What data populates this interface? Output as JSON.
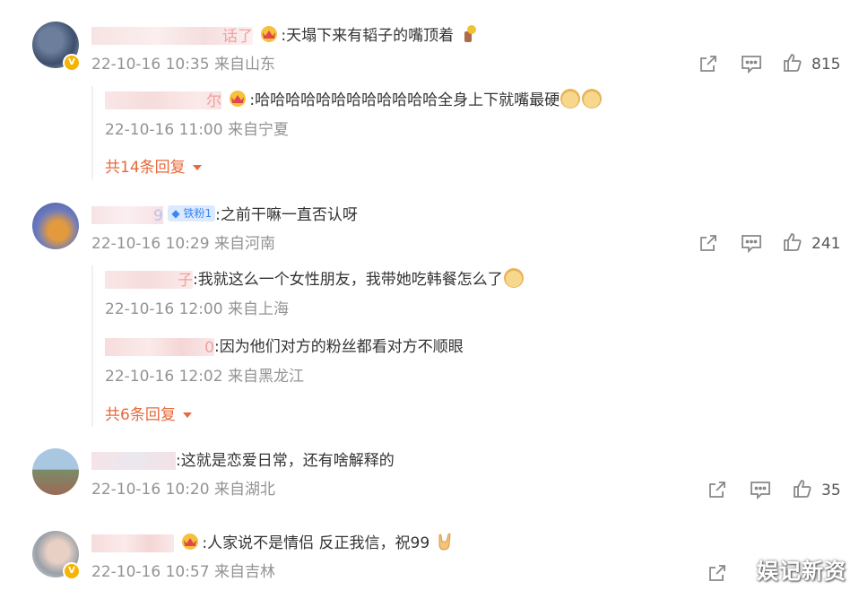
{
  "comments": [
    {
      "name_tail": "话了",
      "text": ":天塌下来有韬子的嘴顶着",
      "meta": "22-10-16 10:35 来自山东",
      "likes": "815",
      "replies": [
        {
          "name_tail": "尔",
          "text": ":哈哈哈哈哈哈哈哈哈哈哈哈全身上下就嘴最硬",
          "meta": "22-10-16 11:00 来自宁夏"
        }
      ],
      "more": "共14条回复"
    },
    {
      "name_tail": "9",
      "fan_badge": "铁粉1",
      "text": ":之前干嘛一直否认呀",
      "meta": "22-10-16 10:29 来自河南",
      "likes": "241",
      "replies": [
        {
          "name_tail": "子",
          "text": ":我就这么一个女性朋友，我带她吃韩餐怎么了",
          "meta": "22-10-16 12:00 来自上海"
        },
        {
          "name_tail": "0",
          "text": ":因为他们对方的粉丝都看对方不顺眼",
          "meta": "22-10-16 12:02 来自黑龙江"
        }
      ],
      "more": "共6条回复"
    },
    {
      "text": ":这就是恋爱日常，还有啥解释的",
      "meta": "22-10-16 10:20 来自湖北",
      "likes": "35"
    },
    {
      "text": ":人家说不是情侣 反正我信，祝99",
      "meta": "22-10-16 10:57 来自吉林"
    }
  ],
  "watermark": "娱记新资",
  "icons": {
    "share": "share-icon",
    "comment": "comment-icon",
    "like": "thumbs-up-icon",
    "crown": "crown-badge-icon",
    "doge": "doge-emoji-icon",
    "expand": "caret-down-icon"
  },
  "colors": {
    "link_orange": "#e8683b",
    "meta_gray": "#939393",
    "vip_gold": "#f5b400",
    "fan_badge_blue": "#3b86f5"
  }
}
